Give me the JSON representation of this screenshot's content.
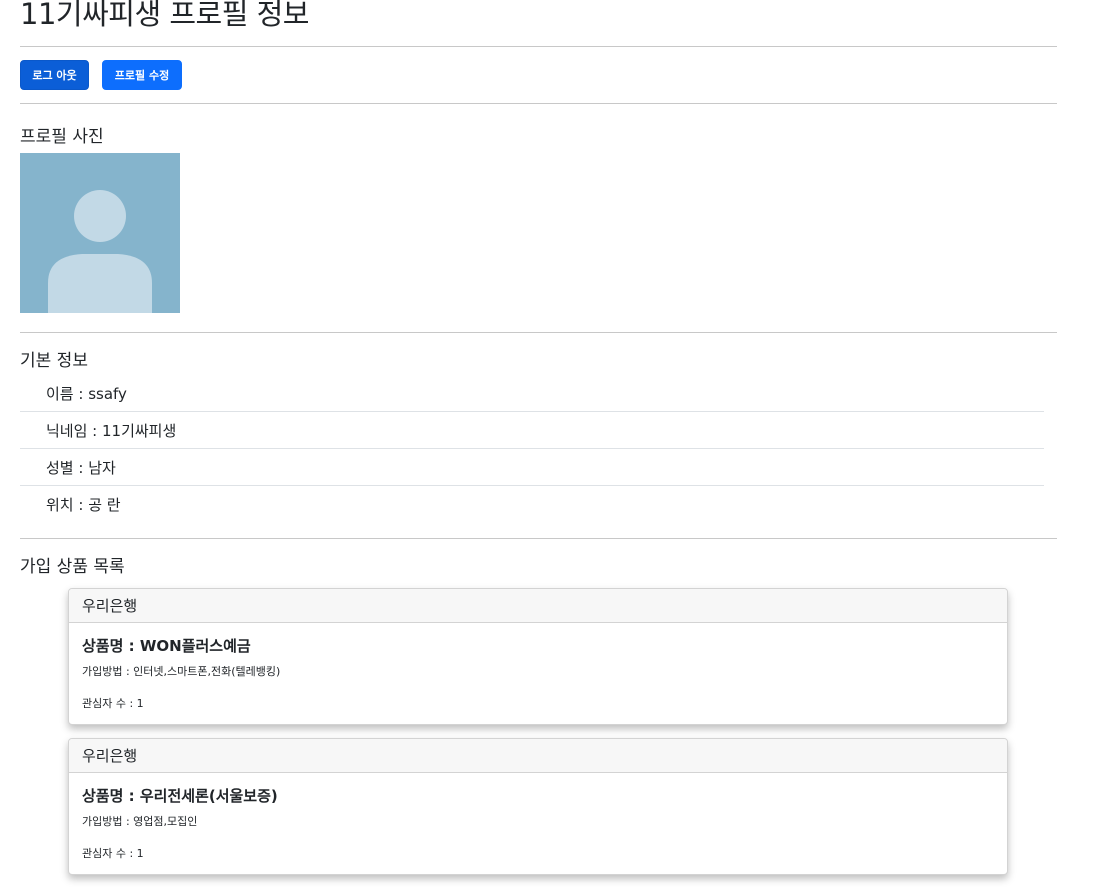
{
  "header": {
    "title": "11기싸피생 프로필 정보"
  },
  "actions": {
    "logout_label": "로그 아웃",
    "edit_profile_label": "프로필 수정"
  },
  "profile_photo": {
    "section_title": "프로필 사진",
    "icon": "default-avatar-icon",
    "bg_color": "#85b4cc"
  },
  "basic_info": {
    "section_title": "기본 정보",
    "items": [
      "이름 : ssafy",
      "닉네임 : 11기싸피생",
      "성별 : 남자",
      "위치 : 공 란"
    ]
  },
  "products": {
    "section_title": "가입 상품 목록",
    "cards": [
      {
        "bank": "우리은행",
        "name": "상품명 : WON플러스예금",
        "join_method": "가입방법 : 인터넷,스마트폰,전화(텔레뱅킹)",
        "interest": "관심자 수 : 1"
      },
      {
        "bank": "우리은행",
        "name": "상품명 : 우리전세론(서울보증)",
        "join_method": "가입방법 : 영업점,모집인",
        "interest": "관심자 수 : 1"
      }
    ]
  },
  "colors": {
    "primary": "#0d6efd",
    "primary_active": "#0b5ed7"
  }
}
